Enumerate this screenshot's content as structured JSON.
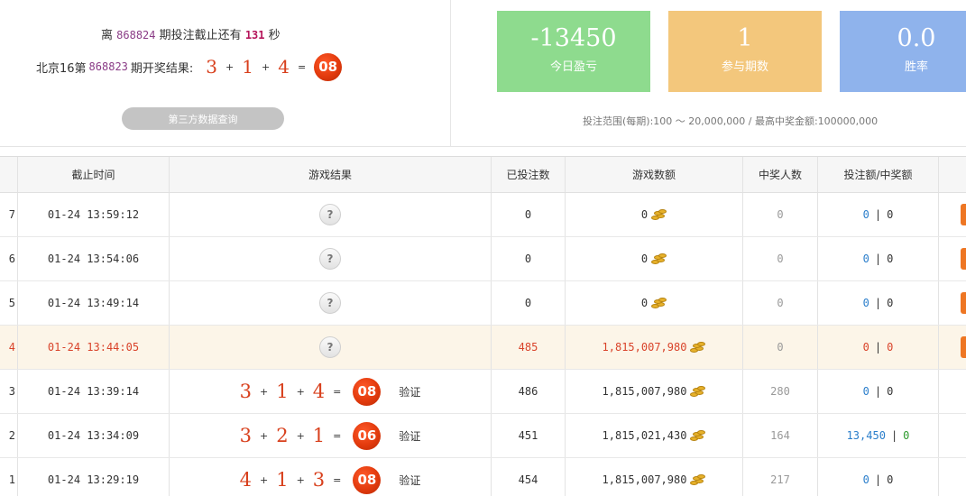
{
  "countdown": {
    "prefix": "离",
    "issue": "868824",
    "middle": "期投注截止还有",
    "seconds": "131",
    "suffix": "秒"
  },
  "last_result": {
    "prefix": "北京16第",
    "issue": "868823",
    "suffix": "期开奖结果:",
    "n1": "3",
    "n2": "1",
    "n3": "4",
    "sum": "08"
  },
  "third_party_button": "第三方数据查询",
  "stats": [
    {
      "value": "-13450",
      "label": "今日盈亏"
    },
    {
      "value": "1",
      "label": "参与期数"
    },
    {
      "value": "0.0",
      "label": "胜率"
    }
  ],
  "range_text": "投注范围(每期):100 ～ 20,000,000 / 最高中奖金额:100000,000",
  "columns": [
    "截止时间",
    "游戏结果",
    "已投注数",
    "游戏数额",
    "中奖人数",
    "投注额/中奖额"
  ],
  "rows": [
    {
      "id": "7",
      "time": "01-24 13:59:12",
      "result": null,
      "bets": "0",
      "amount": "0",
      "winners": "0",
      "bet": "0",
      "win": "0",
      "highlight": false,
      "action": true
    },
    {
      "id": "6",
      "time": "01-24 13:54:06",
      "result": null,
      "bets": "0",
      "amount": "0",
      "winners": "0",
      "bet": "0",
      "win": "0",
      "highlight": false,
      "action": true
    },
    {
      "id": "5",
      "time": "01-24 13:49:14",
      "result": null,
      "bets": "0",
      "amount": "0",
      "winners": "0",
      "bet": "0",
      "win": "0",
      "highlight": false,
      "action": true
    },
    {
      "id": "4",
      "time": "01-24 13:44:05",
      "result": null,
      "bets": "485",
      "amount": "1,815,007,980",
      "winners": "0",
      "bet": "0",
      "win": "0",
      "highlight": true,
      "action": true
    },
    {
      "id": "3",
      "time": "01-24 13:39:14",
      "result": {
        "n1": "3",
        "n2": "1",
        "n3": "4",
        "sum": "08"
      },
      "bets": "486",
      "amount": "1,815,007,980",
      "winners": "280",
      "bet": "0",
      "win": "0",
      "highlight": false,
      "action": false
    },
    {
      "id": "2",
      "time": "01-24 13:34:09",
      "result": {
        "n1": "3",
        "n2": "2",
        "n3": "1",
        "sum": "06"
      },
      "bets": "451",
      "amount": "1,815,021,430",
      "winners": "164",
      "bet": "13,450",
      "win": "0",
      "highlight": false,
      "action": false,
      "win_green": true
    },
    {
      "id": "1",
      "time": "01-24 13:29:19",
      "result": {
        "n1": "4",
        "n2": "1",
        "n3": "3",
        "sum": "08"
      },
      "bets": "454",
      "amount": "1,815,007,980",
      "winners": "217",
      "bet": "0",
      "win": "0",
      "highlight": false,
      "action": false
    }
  ],
  "unknown_mark": "?",
  "plus": "+",
  "equals": "=",
  "verify_label": "验证",
  "bet_win_separator": "|",
  "icons": {
    "coins": "coin-stack-icon",
    "pending": "question-mark-icon"
  },
  "colors": {
    "profit_box": "#8edb8e",
    "periods_box": "#f3c77c",
    "winrate_box": "#8fb3ec",
    "ball": "#e23a0d",
    "highlight_row": "#fcf5e8",
    "action_tab": "#ee7623"
  }
}
